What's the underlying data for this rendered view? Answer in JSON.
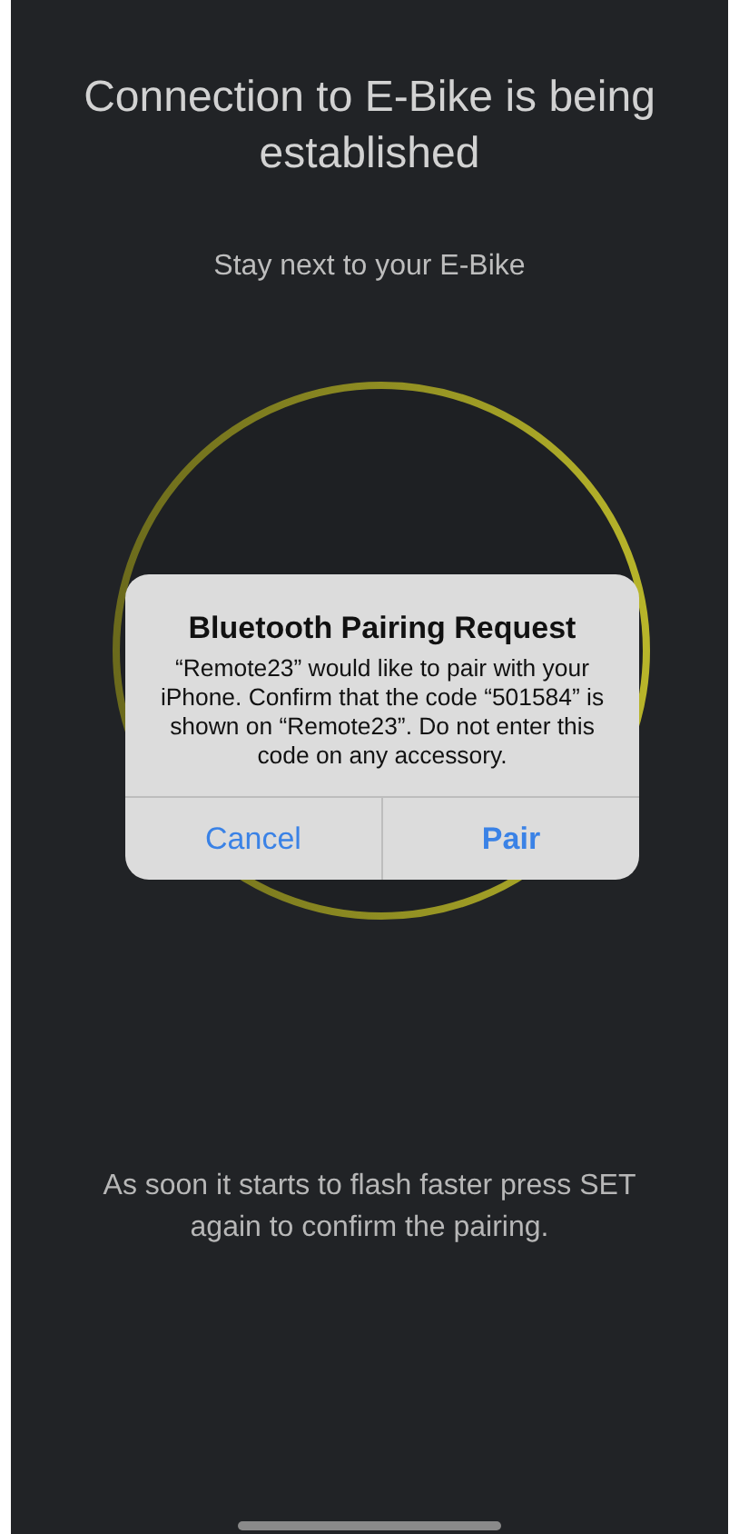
{
  "screen": {
    "title": "Connection to E-Bike is being established",
    "subtitle": "Stay next to your E-Bike",
    "instruction": "As soon it starts to flash faster press SET again to confirm the pairing."
  },
  "dialog": {
    "title": "Bluetooth Pairing Request",
    "message": "“Remote23” would like to pair with your iPhone. Confirm that the code “501584” is shown on “Remote23”. Do not enter this code on any accessory.",
    "buttons": [
      {
        "label": "Cancel",
        "kind": "cancel"
      },
      {
        "label": "Pair",
        "kind": "default"
      }
    ]
  }
}
